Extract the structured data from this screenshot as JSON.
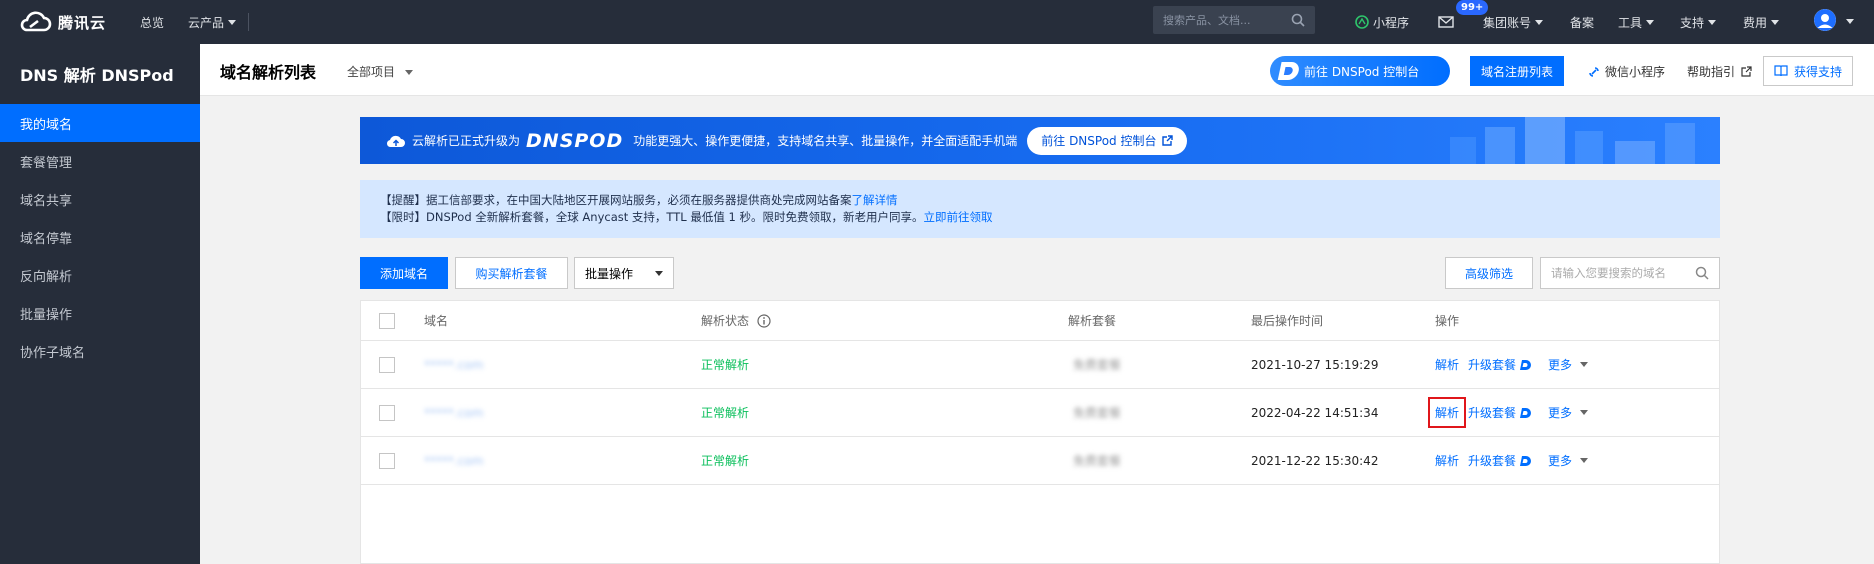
{
  "topbar": {
    "brand": "腾讯云",
    "nav": [
      "总览",
      "云产品"
    ],
    "search_placeholder": "搜索产品、文档...",
    "miniprogram": "小程序",
    "badge": "99+",
    "account": "集团账号",
    "beian": "备案",
    "tools": "工具",
    "support": "支持",
    "billing": "费用"
  },
  "sidebar": {
    "title": "DNS 解析 DNSPod",
    "items": [
      {
        "label": "我的域名",
        "active": true
      },
      {
        "label": "套餐管理"
      },
      {
        "label": "域名共享"
      },
      {
        "label": "域名停靠"
      },
      {
        "label": "反向解析"
      },
      {
        "label": "批量操作"
      },
      {
        "label": "协作子域名"
      }
    ]
  },
  "header": {
    "title": "域名解析列表",
    "project": "全部项目",
    "dnspod_button": "前往 DNSPod 控制台",
    "register_button": "域名注册列表",
    "wechat_link": "微信小程序",
    "help_link": "帮助指引",
    "support_button": "获得支持"
  },
  "banner": {
    "prefix": "云解析已正式升级为",
    "brand": "DNSPOD",
    "text": "功能更强大、操作更便捷，支持域名共享、批量操作，并全面适配手机端",
    "button": "前往 DNSPod 控制台"
  },
  "notice": {
    "line1": "【提醒】据工信部要求，在中国大陆地区开展网站服务，必须在服务器提供商处完成网站备案",
    "line1_link": "了解详情",
    "line2": "【限时】DNSPod 全新解析套餐，全球 Anycast 支持，TTL 最低值 1 秒。限时免费领取，新老用户同享。",
    "line2_link": "立即前往领取"
  },
  "toolbar": {
    "add": "添加域名",
    "buy": "购买解析套餐",
    "batch": "批量操作",
    "advanced": "高级筛选",
    "search_placeholder": "请输入您要搜索的域名"
  },
  "table": {
    "columns": [
      "域名",
      "解析状态",
      "解析套餐",
      "最后操作时间",
      "操作"
    ],
    "rows": [
      {
        "domain": "*****.com",
        "status": "正常解析",
        "plan": "免费套餐",
        "time": "2021-10-27 15:19:29",
        "resolve": "解析",
        "upgrade": "升级套餐",
        "more": "更多"
      },
      {
        "domain": "*****.com",
        "status": "正常解析",
        "plan": "免费套餐",
        "time": "2022-04-22 14:51:34",
        "resolve": "解析",
        "upgrade": "升级套餐",
        "more": "更多"
      },
      {
        "domain": "*****.com",
        "status": "正常解析",
        "plan": "免费套餐",
        "time": "2021-12-22 15:30:42",
        "resolve": "解析",
        "upgrade": "升级套餐",
        "more": "更多"
      }
    ]
  },
  "colors": {
    "primary": "#006eff",
    "sidebar_bg": "#262d3a",
    "status_ok": "#0abf5b",
    "highlight": "#e0161b"
  }
}
